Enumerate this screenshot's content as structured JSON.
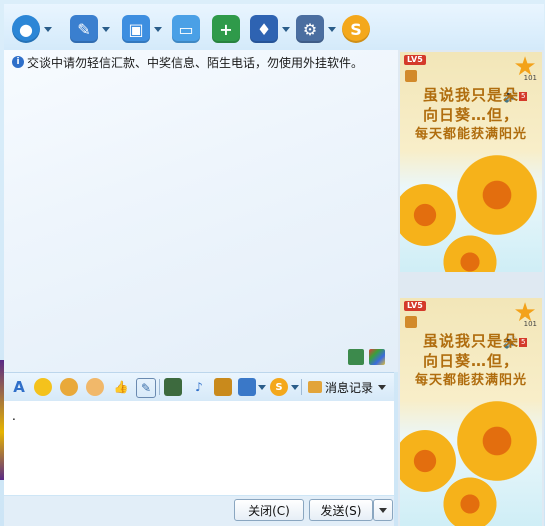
{
  "toolbar": {
    "items": [
      {
        "icon": "webcam-icon"
      },
      {
        "icon": "microphone-icon"
      },
      {
        "icon": "send-file-icon"
      },
      {
        "icon": "remote-assist-icon"
      },
      {
        "icon": "add-app-icon"
      },
      {
        "icon": "profile-icon"
      },
      {
        "icon": "settings-icon"
      },
      {
        "icon": "soso-icon"
      }
    ]
  },
  "chat": {
    "notice": "交谈中请勿轻信汇款、中奖信息、陌生电话，勿使用外挂软件。"
  },
  "format_bar": {
    "font_glyph": "A",
    "history_label": "消息记录"
  },
  "input": {
    "text": "."
  },
  "buttons": {
    "close_label": "关闭(C)",
    "send_label": "发送(S)"
  },
  "show": {
    "level": "LV5",
    "star_count": "101",
    "badge": "5",
    "line1": "虽说我只是朵",
    "line2": "向日葵…但，",
    "line3": "每天都能获满阳光"
  },
  "colors": {
    "accent": "#2f6fc9",
    "toolbar_bg": "#d4eafa",
    "show_text": "#b06d0e"
  }
}
